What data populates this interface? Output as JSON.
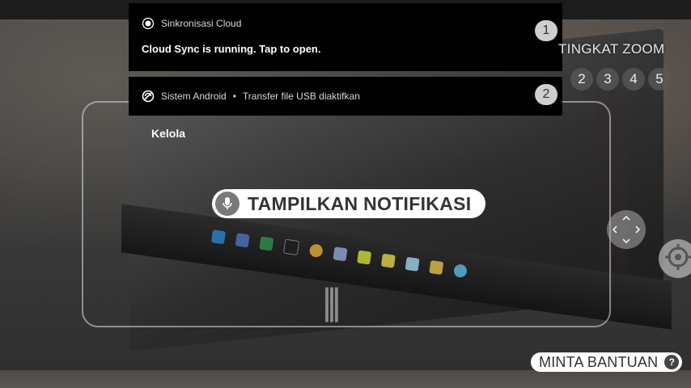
{
  "notifications": [
    {
      "app_icon": "cloud-sync-app-icon",
      "app_name": "Sinkronisasi Cloud",
      "body": "Cloud Sync is running. Tap to open.",
      "number": "1"
    },
    {
      "app_icon": "android-system-icon",
      "app_name": "Sistem Android",
      "separator": "•",
      "title": "Transfer file USB diaktifkan",
      "number": "2"
    }
  ],
  "manage_label": "Kelola",
  "voice_command": {
    "icon": "microphone-icon",
    "label": "TAMPILKAN NOTIFIKASI"
  },
  "zoom": {
    "title": "TINGKAT ZOOM",
    "levels": [
      "2",
      "3",
      "4",
      "5"
    ]
  },
  "controls": {
    "move_icon": "move-arrows-icon",
    "target_icon": "crosshair-icon"
  },
  "help": {
    "label": "MINTA BANTUAN",
    "icon_label": "?"
  },
  "colors": {
    "notification_bg": "#000000",
    "pill_bg": "#ffffff",
    "badge_bg": "#cfcfcf"
  }
}
